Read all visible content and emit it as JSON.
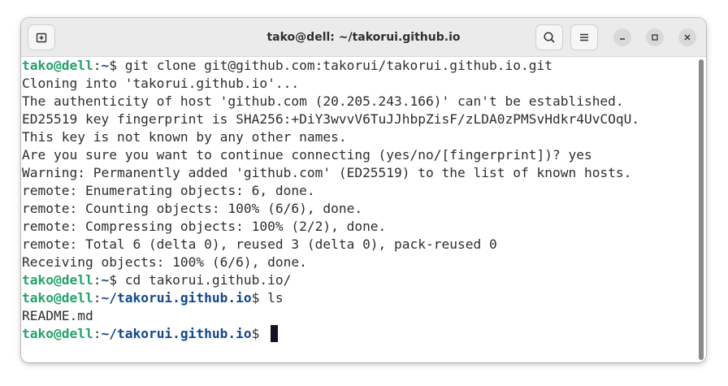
{
  "window": {
    "title": "tako@dell: ~/takorui.github.io"
  },
  "titlebar": {
    "new_tab_icon": "new-tab-icon",
    "search_icon": "search-icon",
    "menu_icon": "hamburger-menu-icon",
    "minimize_icon": "minimize-icon",
    "maximize_icon": "maximize-icon",
    "close_icon": "close-icon"
  },
  "colors": {
    "prompt_user": "#26a269",
    "prompt_path": "#12488b",
    "text": "#2e2e2e"
  },
  "terminal": {
    "lines": [
      {
        "user": "tako@dell",
        "sep": ":",
        "path": "~",
        "cmd": "$ git clone git@github.com:takorui/takorui.github.io.git"
      },
      {
        "text": "Cloning into 'takorui.github.io'..."
      },
      {
        "text": "The authenticity of host 'github.com (20.205.243.166)' can't be established."
      },
      {
        "text": "ED25519 key fingerprint is SHA256:+DiY3wvvV6TuJJhbpZisF/zLDA0zPMSvHdkr4UvCOqU."
      },
      {
        "text": "This key is not known by any other names."
      },
      {
        "text": "Are you sure you want to continue connecting (yes/no/[fingerprint])? yes"
      },
      {
        "text": "Warning: Permanently added 'github.com' (ED25519) to the list of known hosts."
      },
      {
        "text": "remote: Enumerating objects: 6, done."
      },
      {
        "text": "remote: Counting objects: 100% (6/6), done."
      },
      {
        "text": "remote: Compressing objects: 100% (2/2), done."
      },
      {
        "text": "remote: Total 6 (delta 0), reused 3 (delta 0), pack-reused 0"
      },
      {
        "text": "Receiving objects: 100% (6/6), done."
      },
      {
        "user": "tako@dell",
        "sep": ":",
        "path": "~",
        "cmd": "$ cd takorui.github.io/"
      },
      {
        "user": "tako@dell",
        "sep": ":",
        "path": "~/takorui.github.io",
        "cmd": "$ ls"
      },
      {
        "text": "README.md"
      },
      {
        "user": "tako@dell",
        "sep": ":",
        "path": "~/takorui.github.io",
        "cmd": "$ "
      }
    ]
  }
}
